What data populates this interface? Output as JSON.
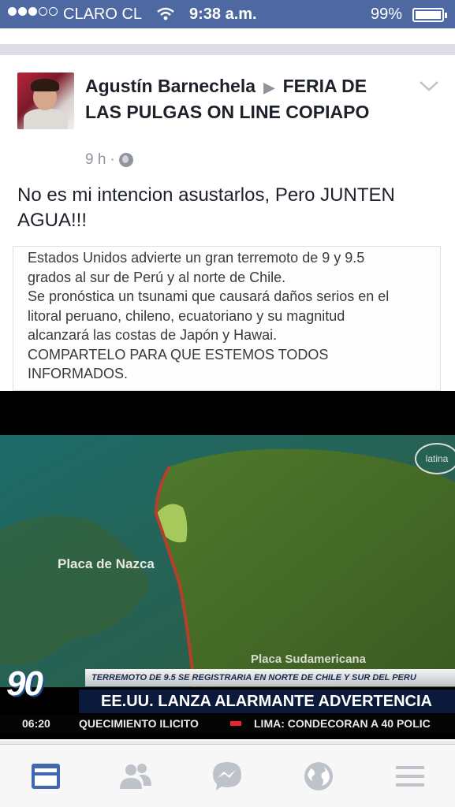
{
  "status_bar": {
    "carrier": "CLARO CL",
    "time": "9:38 a.m.",
    "battery_percent": "99%",
    "signal_dots_filled": 3,
    "signal_dots_total": 5,
    "wifi_icon": "wifi-icon"
  },
  "post": {
    "author": "Agustín Barnechela",
    "separator_icon": "play-arrow-icon",
    "group": "FERIA DE LAS PULGAS ON LINE COPIAPO",
    "time_ago": "9 h",
    "privacy_icon": "globe-icon",
    "menu_icon": "chevron-down-icon",
    "text": "No es mi intencion asustarlos, Pero JUNTEN AGUA!!!"
  },
  "shared_image": {
    "caption": "Estados Unidos advierte un gran terremoto de 9 y 9.5\ngrados al sur de Perú y al norte de Chile.\nSe pronóstica un tsunami que causará daños serios en el\nlitoral peruano, chileno, ecuatoriano y su magnitud\nalcanzará las costas de Japón y Hawai.\nCOMPARTELO PARA QUE ESTEMOS TODOS\nINFORMADOS.",
    "channel_logo": "latina",
    "plate_left": "Placa de Nazca",
    "plate_right": "Placa Sudamericana",
    "news_badge": "90",
    "headline_small": "TERREMOTO DE 9.5 SE REGISTRARIA EN NORTE DE CHILE Y SUR DEL PERU",
    "headline_main": "EE.UU. LANZA ALARMANTE ADVERTENCIA",
    "ticker_time": "06:20",
    "ticker_item_1": "QUECIMIENTO ILICITO",
    "ticker_item_2": "LIMA: CONDECORAN A 40 POLIC"
  },
  "bottom_nav": {
    "items": [
      {
        "icon": "news-feed-icon",
        "active": true
      },
      {
        "icon": "friends-icon",
        "active": false
      },
      {
        "icon": "messenger-icon",
        "active": false
      },
      {
        "icon": "globe-notifications-icon",
        "active": false
      },
      {
        "icon": "menu-icon",
        "active": false
      }
    ]
  },
  "colors": {
    "status_bar_bg": "#4e69a2",
    "nav_active": "#4267b2",
    "nav_inactive": "#bec2c9",
    "text_primary": "#1d2129",
    "text_secondary": "#90949c"
  }
}
